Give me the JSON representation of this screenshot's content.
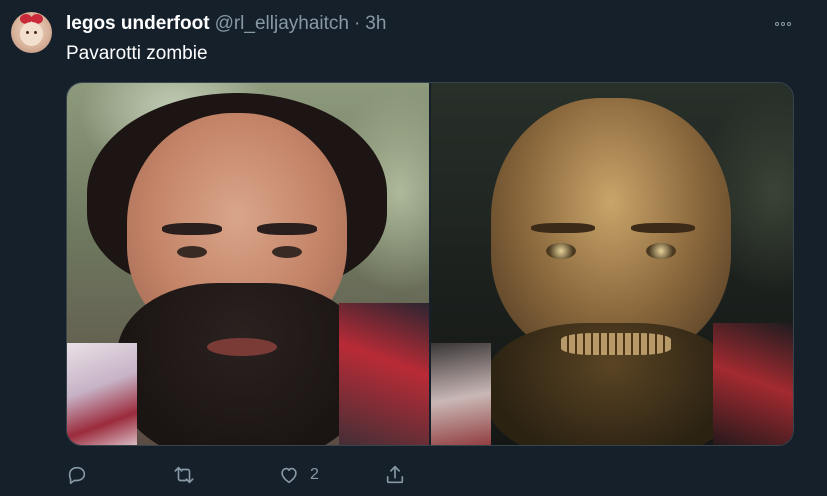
{
  "tweet": {
    "author_name": "legos underfoot",
    "author_handle": "@rl_elljayhaitch",
    "separator": "·",
    "timestamp": "3h",
    "text": "Pavarotti zombie",
    "media": [
      {
        "label": "photo-original"
      },
      {
        "label": "photo-zombie"
      }
    ],
    "actions": {
      "reply_icon": "reply-icon",
      "retweet_icon": "retweet-icon",
      "like_icon": "heart-icon",
      "like_count": "2",
      "share_icon": "share-icon"
    },
    "more_icon": "more-options-icon"
  },
  "colors": {
    "background": "#15202b",
    "text_primary": "#ffffff",
    "text_secondary": "#8899a6",
    "border": "#38444d"
  }
}
